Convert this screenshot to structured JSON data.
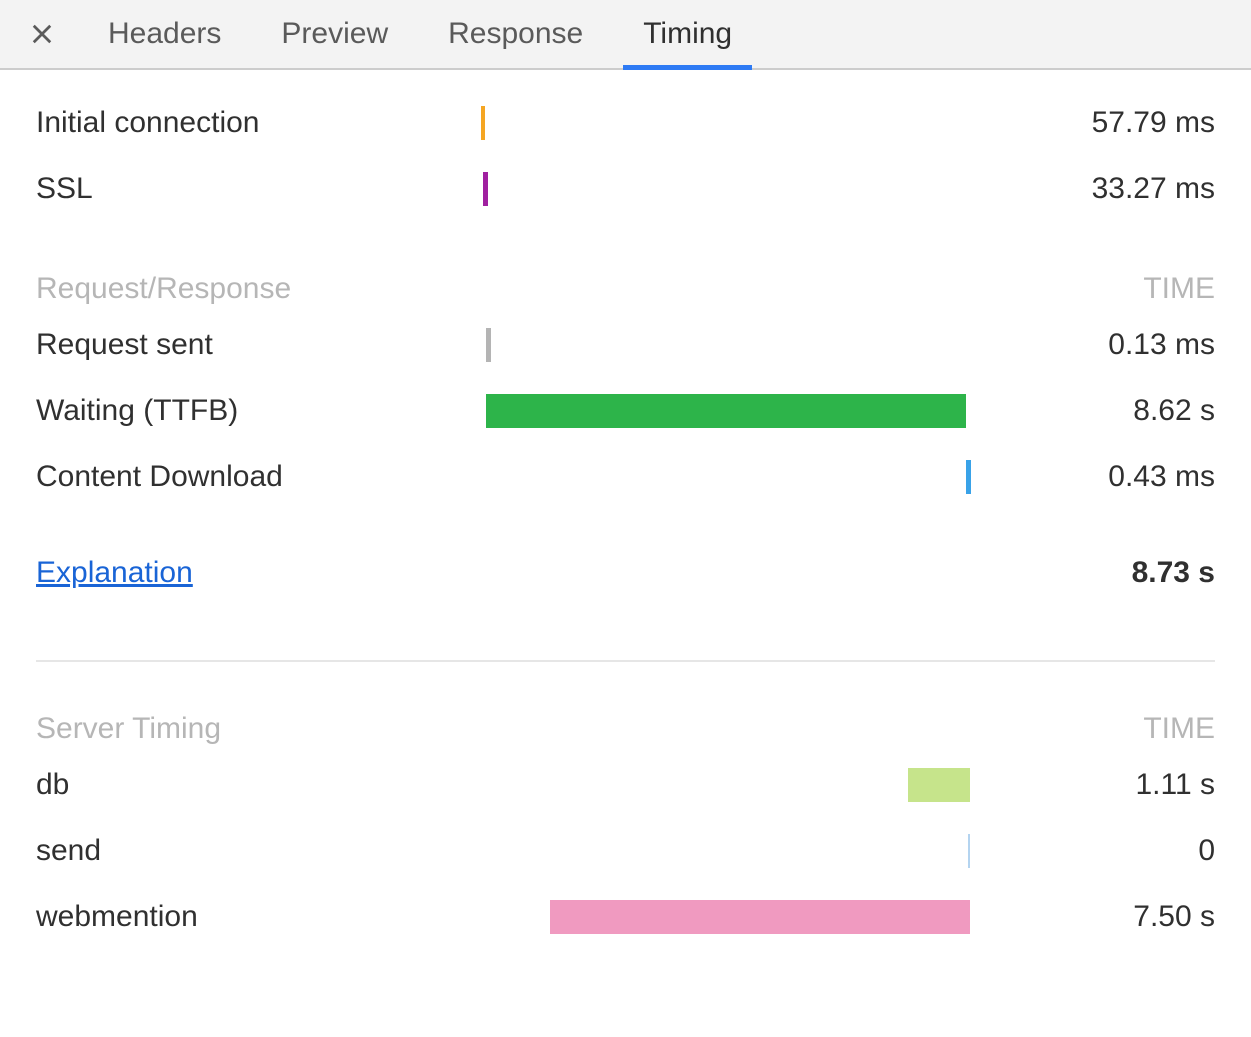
{
  "tabs": {
    "headers": "Headers",
    "preview": "Preview",
    "response": "Response",
    "timing": "Timing"
  },
  "connection_rows": [
    {
      "label": "Initial connection",
      "value": "57.79 ms",
      "bar": {
        "left_pct": 0.0,
        "width_pct": 0.8,
        "color": "#f5a623"
      }
    },
    {
      "label": "SSL",
      "value": "33.27 ms",
      "bar": {
        "left_pct": 0.4,
        "width_pct": 1.0,
        "color": "#a020a0"
      }
    }
  ],
  "req_resp": {
    "title": "Request/Response",
    "time_label": "TIME",
    "rows": [
      {
        "label": "Request sent",
        "value": "0.13 ms",
        "bar": {
          "left_pct": 1.0,
          "width_pct": 1.0,
          "color": "#b4b4b4"
        }
      },
      {
        "label": "Waiting (TTFB)",
        "value": "8.62 s",
        "bar": {
          "left_pct": 1.0,
          "width_pct": 98.0,
          "color": "#2db44a"
        }
      },
      {
        "label": "Content Download",
        "value": "0.43 ms",
        "bar": {
          "left_pct": 99.0,
          "width_pct": 1.0,
          "color": "#39a2e8"
        }
      }
    ]
  },
  "explanation": {
    "link_label": "Explanation",
    "total": "8.73 s"
  },
  "server_timing": {
    "title": "Server Timing",
    "time_label": "TIME",
    "rows": [
      {
        "label": "db",
        "value": "1.11 s",
        "bar": {
          "left_pct": 87.2,
          "width_pct": 12.7,
          "color": "#c6e48b"
        }
      },
      {
        "label": "send",
        "value": "0",
        "bar": {
          "left_pct": 99.4,
          "width_pct": 0.5,
          "color": "#b4d4f0"
        }
      },
      {
        "label": "webmention",
        "value": "7.50 s",
        "bar": {
          "left_pct": 14.1,
          "width_pct": 85.8,
          "color": "#f09ac0"
        }
      }
    ]
  }
}
